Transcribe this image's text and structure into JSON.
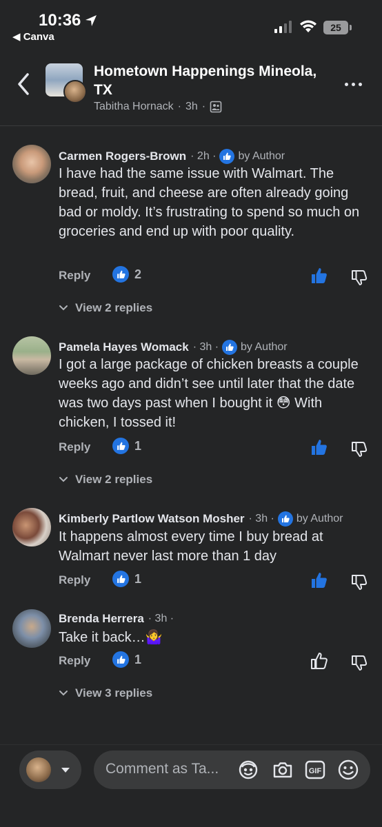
{
  "status_bar": {
    "time": "10:36",
    "back_app": "◀ Canva",
    "battery": "25"
  },
  "header": {
    "title": "Hometown Happenings Mineola, TX",
    "author": "Tabitha Hornack",
    "age": "3h",
    "sep": "·"
  },
  "comments": [
    {
      "name": "Carmen Rogers-Brown",
      "age": "· 2h ·",
      "badge": "by Author",
      "text": "I have had the same issue with Walmart. The bread, fruit, and cheese are often already going bad or moldy. It’s frustrating to spend so much on groceries and end up with poor quality.",
      "reply_label": "Reply",
      "likes": "2",
      "liked": true,
      "view_replies": "View 2 replies"
    },
    {
      "name": "Pamela Hayes Womack",
      "age": "· 3h ·",
      "badge": "by Author",
      "text": "I got a large package of chicken breasts a couple weeks ago and didn’t see until later that the date was two days past when I bought it 😳 With chicken, I tossed it!",
      "reply_label": "Reply",
      "likes": "1",
      "liked": true,
      "view_replies": "View 2 replies"
    },
    {
      "name": "Kimberly Partlow Watson Mosher",
      "age": "· 3h ·",
      "badge": "by Author",
      "text": "It happens almost every time I buy bread at Walmart never last more than 1 day",
      "reply_label": "Reply",
      "likes": "1",
      "liked": true,
      "view_replies": ""
    },
    {
      "name": "Brenda Herrera",
      "age": "· 3h ·",
      "badge": "",
      "text": "Take it back…🤷‍♀️",
      "reply_label": "Reply",
      "likes": "1",
      "liked": false,
      "view_replies": "View 3 replies"
    }
  ],
  "composer": {
    "placeholder": "Comment as Ta..."
  },
  "colors": {
    "background": "#242526",
    "accent_blue": "#2374e1",
    "text_primary": "#e4e6eb",
    "text_secondary": "#b0b3b8"
  },
  "icons": [
    "location-arrow-icon",
    "signal-icon",
    "wifi-icon",
    "battery-icon",
    "back-chevron-icon",
    "more-dots-icon",
    "people-icon",
    "author-badge-icon",
    "like-badge-icon",
    "thumb-up-icon",
    "thumb-down-icon",
    "chevron-down-icon",
    "avatar-sticker-icon",
    "camera-icon",
    "gif-icon",
    "emoji-icon"
  ]
}
